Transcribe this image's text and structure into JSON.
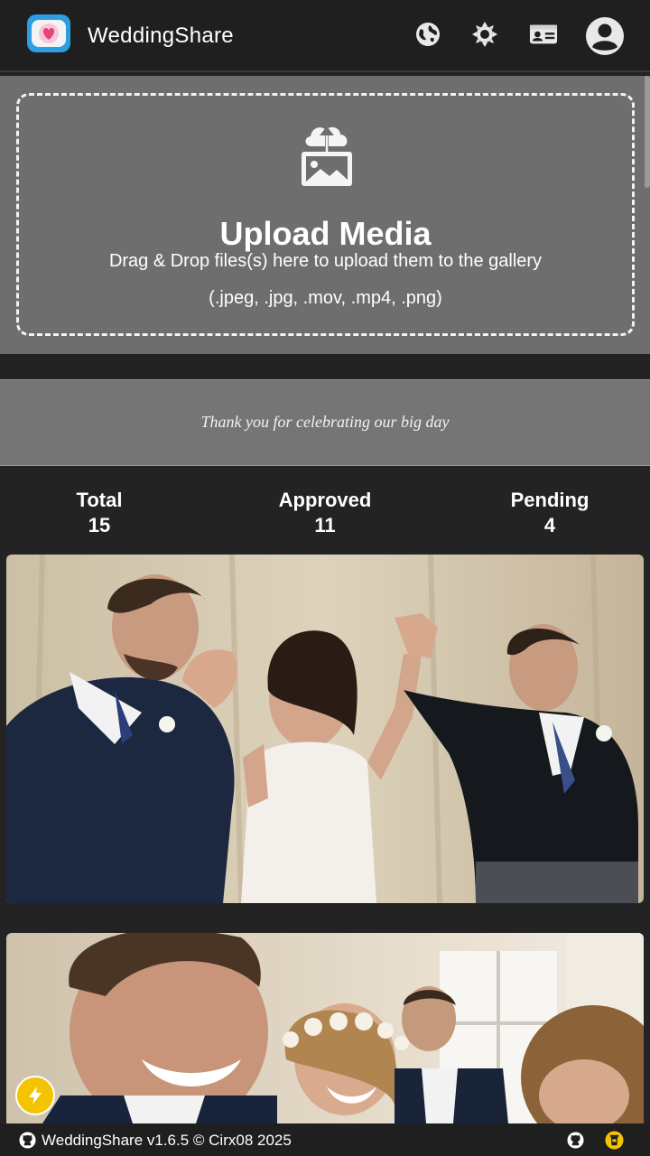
{
  "header": {
    "brand": "WeddingShare",
    "icons": [
      "globe-icon",
      "brightness-icon",
      "id-card-icon",
      "account-icon"
    ]
  },
  "upload": {
    "title": "Upload Media",
    "subtitle": "Drag & Drop files(s) here to upload them to the gallery",
    "types": "(.jpeg, .jpg, .mov, .mp4, .png)"
  },
  "banner": {
    "message": "Thank you for celebrating our big day"
  },
  "stats": {
    "total": {
      "label": "Total",
      "value": "15"
    },
    "approved": {
      "label": "Approved",
      "value": "11"
    },
    "pending": {
      "label": "Pending",
      "value": "4"
    }
  },
  "gallery": {
    "items": [
      "wedding-photo-celebration",
      "wedding-photo-guests"
    ]
  },
  "footer": {
    "text": "WeddingShare v1.6.5 © Cirx08 2025"
  },
  "colors": {
    "header_bg": "#1f1f1f",
    "upload_bg": "#6e6e6e",
    "banner_bg": "#757575",
    "accent_yellow": "#f5c400"
  }
}
